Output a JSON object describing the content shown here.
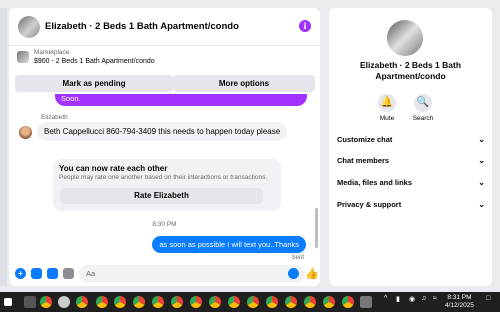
{
  "chat": {
    "title": "Elizabeth · 2 Beds 1 Bath Apartment/condo",
    "info_icon": "i",
    "marketplace": {
      "label": "Marketplace",
      "listing": "$900 - 2 Beds 1 Bath Apartment/condo",
      "mark_pending_label": "Mark as pending",
      "more_options_label": "More options"
    },
    "purple_bubble_text": "Soon.",
    "sender_name": "Elizabeth",
    "incoming_message": "Beth Cappellucci 860-794-3409  this needs to happen today please",
    "rate_card": {
      "title": "You can now rate each other",
      "description": "People may rate one another based on their interactions or transactions.",
      "button_label": "Rate Elizabeth"
    },
    "timestamp": "8:30 PM",
    "outgoing_message": "as soon as possible I will text you..Thanks",
    "sent_label": "Sent",
    "composer_placeholder": "Aa"
  },
  "info_panel": {
    "title": "Elizabeth · 2 Beds 1 Bath Apartment/condo",
    "actions": [
      {
        "label": "Mute",
        "icon": "bell-icon"
      },
      {
        "label": "Search",
        "icon": "search-icon"
      }
    ],
    "sections": [
      "Customize chat",
      "Chat members",
      "Media, files and links",
      "Privacy & support"
    ]
  },
  "taskbar": {
    "time": "8:31 PM",
    "date": "4/12/2025"
  },
  "colors": {
    "accent_blue": "#0a7cff",
    "purple": "#a033ff"
  }
}
